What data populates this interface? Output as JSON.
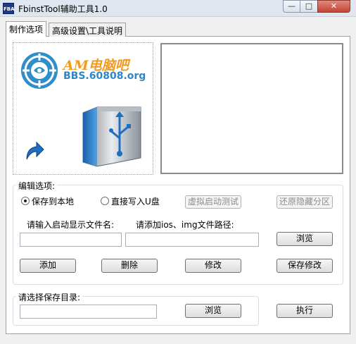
{
  "window": {
    "icon_text": "FBA",
    "title": "FbinstTool辅助工具1.0",
    "controls": {
      "minimize": "—",
      "maximize": "□",
      "close": "✕"
    }
  },
  "tabs": [
    {
      "label": "制作选项",
      "active": true
    },
    {
      "label": "高级设置\\工具说明",
      "active": false
    }
  ],
  "logo": {
    "brand": "AM电脑吧",
    "site": "BBS.60808.org",
    "icons": [
      "target-logo-icon",
      "shortcut-arrow-icon",
      "usb-drive-icon"
    ]
  },
  "edit_group": {
    "title": "编辑选项:",
    "radio_local": "保存到本地",
    "radio_usb": "直接写入U盘",
    "selected": "radio_local",
    "btn_virtual_boot": "虚拟启动测试",
    "btn_restore_hidden": "还原隐藏分区",
    "label_menu_name": "请输入启动显示文件名:",
    "label_image_path": "请添加ios、img文件路径:",
    "input_menu_name": "",
    "input_image_path": "",
    "btn_browse": "浏览",
    "btn_add": "添加",
    "btn_delete": "删除",
    "btn_modify": "修改",
    "btn_save_changes": "保存修改"
  },
  "save_group": {
    "title": "请选择保存目录:",
    "input_dir": "",
    "btn_browse": "浏览"
  },
  "btn_execute": "执行",
  "colors": {
    "titlebar": "#dfe6ef",
    "brand_orange": "#f29a1f",
    "brand_blue": "#2f86c5",
    "close_red": "#c44332"
  }
}
